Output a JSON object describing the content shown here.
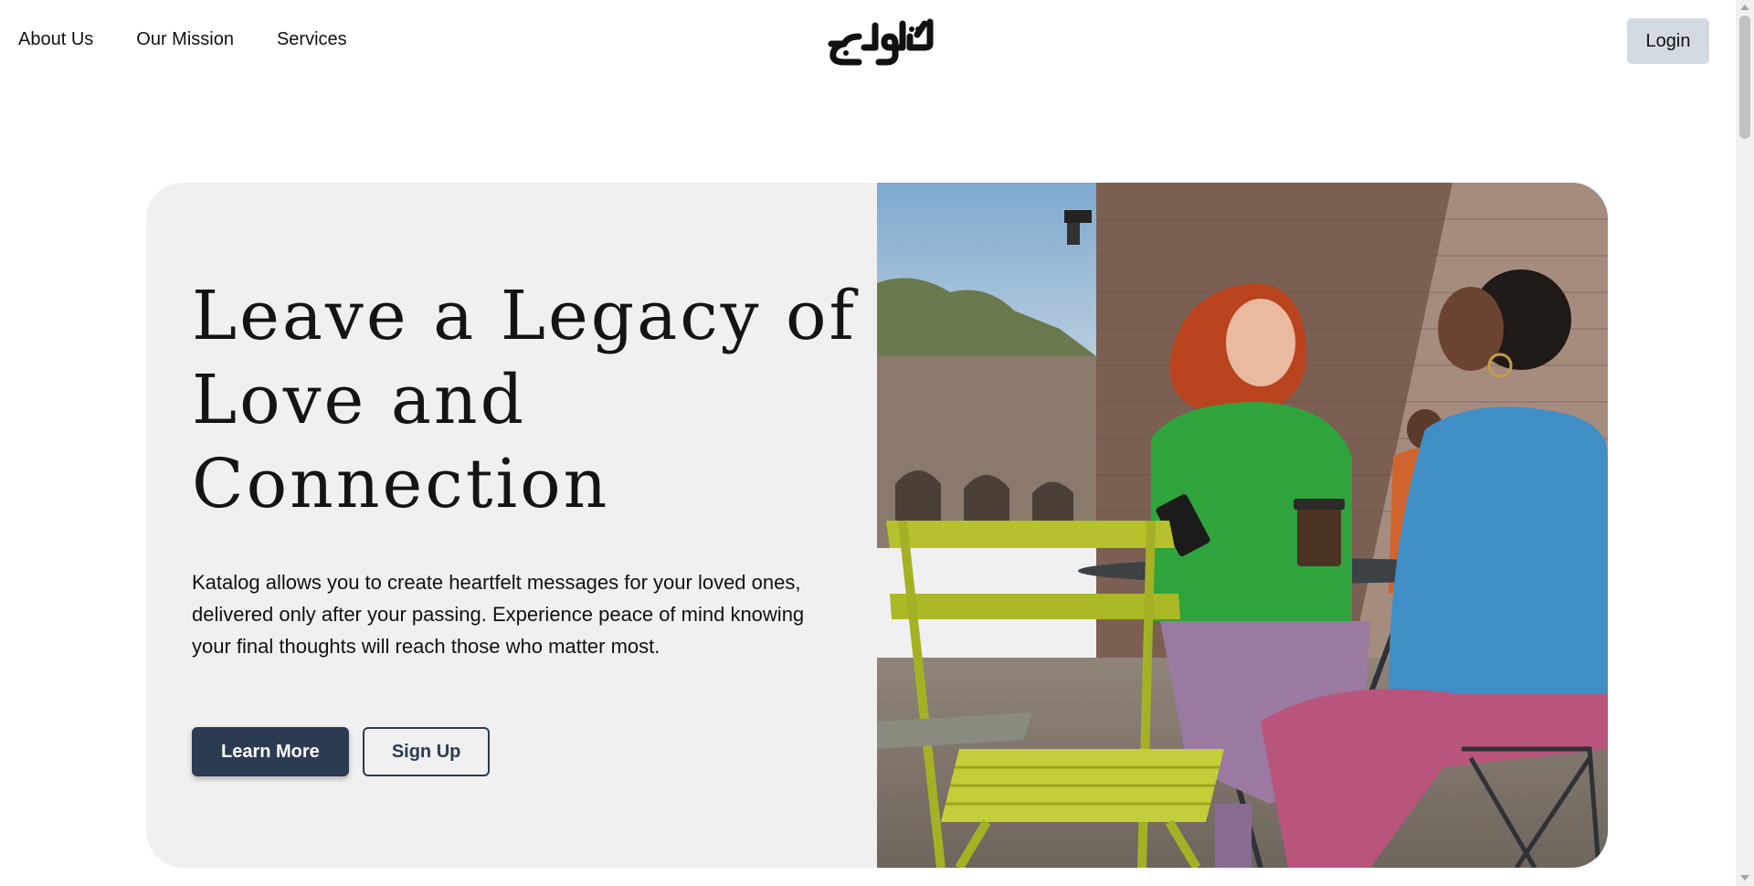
{
  "nav": {
    "links": [
      "About Us",
      "Our Mission",
      "Services"
    ],
    "logo_text": "كتالوج",
    "login_label": "Login"
  },
  "hero": {
    "headline_lines": [
      "Leave a Legacy of",
      "Love and",
      "Connection"
    ],
    "description": "Katalog allows you to create heartfelt messages for your loved ones, delivered only after your passing. Experience peace of mind knowing your final thoughts will reach those who matter most.",
    "primary_button": "Learn More",
    "secondary_button": "Sign Up",
    "photo": "two-women-talking-at-cafe-table"
  },
  "colors": {
    "primary": "#2b3b52",
    "login_bg": "#d4dae2",
    "hero_bg": "#f0f0f0"
  }
}
